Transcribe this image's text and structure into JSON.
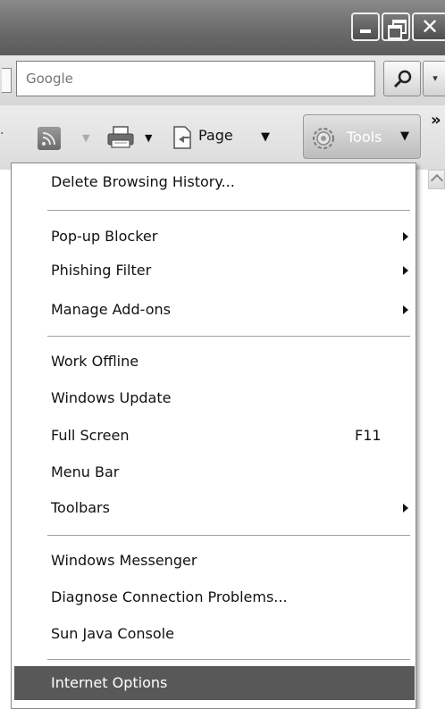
{
  "window": {
    "buttons": {
      "close_glyph": "✕"
    }
  },
  "search": {
    "placeholder": "Google",
    "icon": "magnifier-icon",
    "dropdown_glyph": "▾"
  },
  "command_bar": {
    "page_label": "Page",
    "tools_label": "Tools",
    "arrow_glyph": "▼",
    "small_arrow_glyph": "▼",
    "overflow_glyph": "»",
    "feeds_icon": "feeds-icon",
    "print_icon": "printer-icon",
    "page_icon": "page-icon",
    "tools_icon": "gear-icon"
  },
  "tools_menu": {
    "items": [
      {
        "label": "Delete Browsing History...",
        "submenu": false
      },
      {
        "label": "Pop-up Blocker",
        "submenu": true
      },
      {
        "label": "Phishing Filter",
        "submenu": true
      },
      {
        "label": "Manage Add-ons",
        "submenu": true
      },
      {
        "label": "Work Offline",
        "submenu": false
      },
      {
        "label": "Windows Update",
        "submenu": false
      },
      {
        "label": "Full Screen",
        "shortcut": "F11",
        "submenu": false
      },
      {
        "label": "Menu Bar",
        "submenu": false
      },
      {
        "label": "Toolbars",
        "submenu": true
      },
      {
        "label": "Windows Messenger",
        "submenu": false
      },
      {
        "label": "Diagnose Connection Problems...",
        "submenu": false
      },
      {
        "label": "Sun Java Console",
        "submenu": false
      },
      {
        "label": "Internet Options",
        "submenu": false,
        "highlighted": true
      }
    ],
    "highlight_color": "#585858"
  }
}
